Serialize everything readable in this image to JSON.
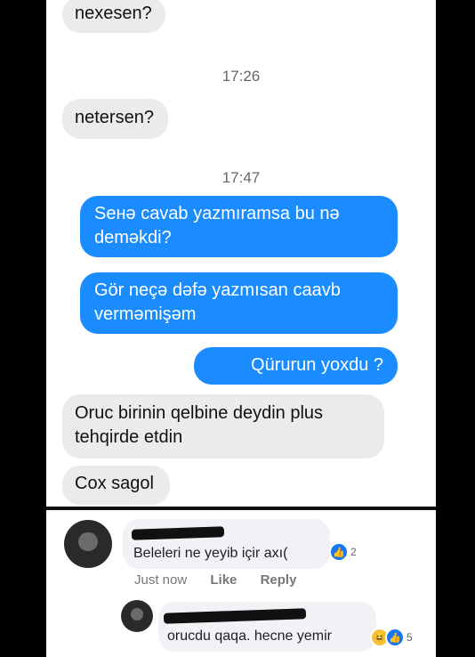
{
  "messages": [
    {
      "text": "nexesen?"
    },
    {
      "text": "netersen?"
    },
    {
      "text": "Sенə cavab yazmıramsa bu nə deməkdi?"
    },
    {
      "text": "Gör neçə dəfə yazmısan caavb verməmişəm"
    },
    {
      "text": "Qürurun yoxdu ?"
    },
    {
      "text": "Oruc birinin qelbine deydin plus tehqirde etdin"
    },
    {
      "text": "Cox sagol"
    }
  ],
  "timestamps": [
    "17:26",
    "17:47"
  ],
  "comments": [
    {
      "text": "Beleleri ne yeyib içir axı(",
      "reaction_icon": "like-icon",
      "reaction_count": "2",
      "time": "Just now",
      "like_label": "Like",
      "reply_label": "Reply"
    },
    {
      "text": "orucdu qaqa. hecne yemir",
      "reaction_icons": [
        "haha-icon",
        "like-icon"
      ],
      "reaction_count": "5"
    }
  ],
  "colors": {
    "outgoing": "#1a8cff",
    "incoming": "#ebebeb",
    "background": "#000000"
  }
}
